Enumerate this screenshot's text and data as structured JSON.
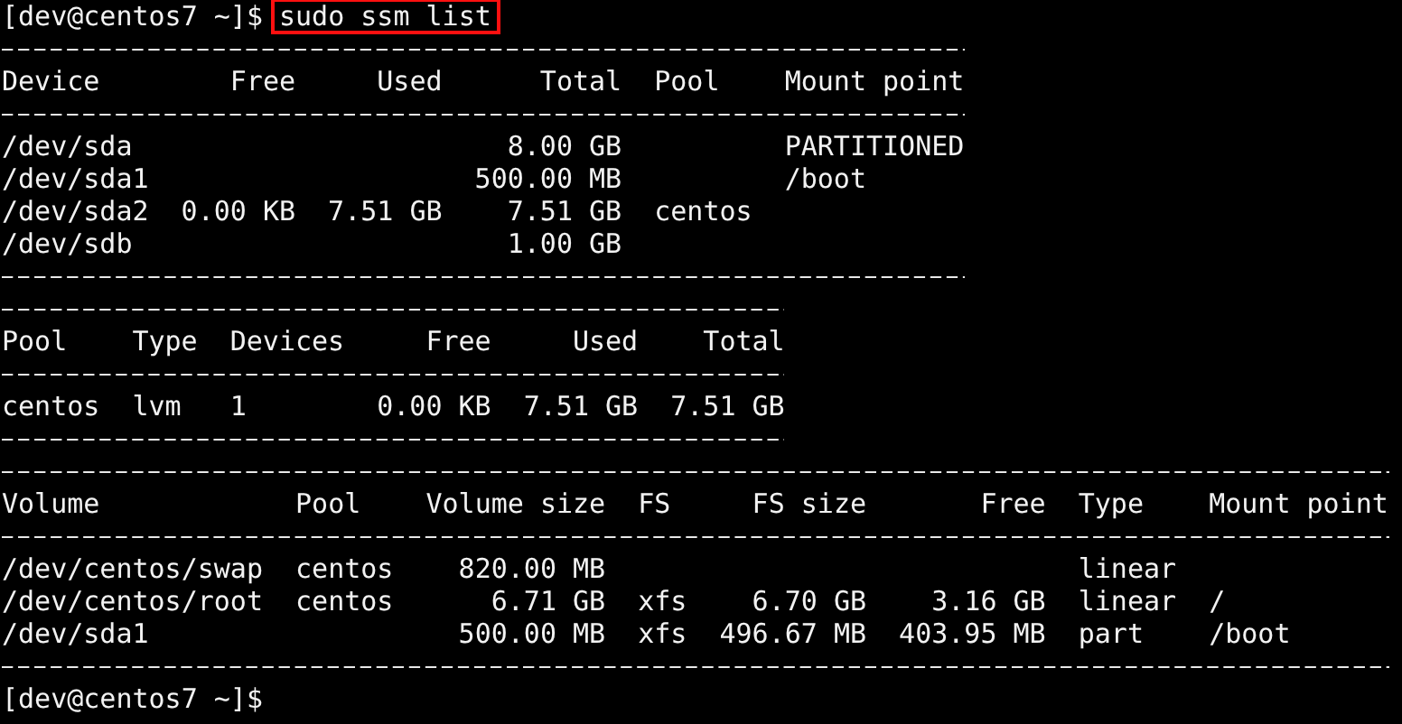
{
  "command_line": {
    "prompt": "[dev@centos7 ~]$",
    "command": "sudo ssm list",
    "highlighted": true
  },
  "tables": [
    {
      "columns": [
        {
          "label": "Device",
          "kind": "text"
        },
        {
          "label": "Free",
          "kind": "number"
        },
        {
          "label": "Used",
          "kind": "number"
        },
        {
          "label": "Total",
          "kind": "number"
        },
        {
          "label": "Pool",
          "kind": "text"
        },
        {
          "label": "Mount point",
          "kind": "text"
        }
      ],
      "rows": [
        [
          "/dev/sda",
          null,
          null,
          "8.00 GB",
          null,
          "PARTITIONED"
        ],
        [
          "/dev/sda1",
          null,
          null,
          "500.00 MB",
          null,
          "/boot"
        ],
        [
          "/dev/sda2",
          "0.00 KB",
          "7.51 GB",
          "7.51 GB",
          "centos",
          null
        ],
        [
          "/dev/sdb",
          null,
          null,
          "1.00 GB",
          null,
          null
        ]
      ]
    },
    {
      "columns": [
        {
          "label": "Pool",
          "kind": "text"
        },
        {
          "label": "Type",
          "kind": "text"
        },
        {
          "label": "Devices",
          "kind": "text"
        },
        {
          "label": "Free",
          "kind": "number"
        },
        {
          "label": "Used",
          "kind": "number"
        },
        {
          "label": "Total",
          "kind": "number"
        }
      ],
      "rows": [
        [
          "centos",
          "lvm",
          "1",
          "0.00 KB",
          "7.51 GB",
          "7.51 GB"
        ]
      ]
    },
    {
      "columns": [
        {
          "label": "Volume",
          "kind": "text"
        },
        {
          "label": "Pool",
          "kind": "text"
        },
        {
          "label": "Volume size",
          "kind": "number"
        },
        {
          "label": "FS",
          "kind": "text"
        },
        {
          "label": "FS size",
          "kind": "number"
        },
        {
          "label": "Free",
          "kind": "number"
        },
        {
          "label": "Type",
          "kind": "text"
        },
        {
          "label": "Mount point",
          "kind": "text"
        }
      ],
      "rows": [
        [
          "/dev/centos/swap",
          "centos",
          "820.00 MB",
          null,
          null,
          null,
          "linear",
          null
        ],
        [
          "/dev/centos/root",
          "centos",
          "6.71 GB",
          "xfs",
          "6.70 GB",
          "3.16 GB",
          "linear",
          "/"
        ],
        [
          "/dev/sda1",
          null,
          "500.00 MB",
          "xfs",
          "496.67 MB",
          "403.95 MB",
          "part",
          "/boot"
        ]
      ]
    }
  ],
  "end_prompt": "[dev@centos7 ~]$"
}
